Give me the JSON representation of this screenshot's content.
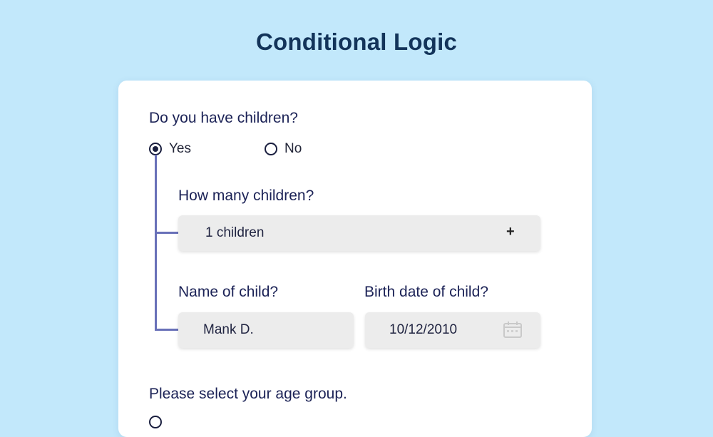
{
  "title": "Conditional Logic",
  "form": {
    "q1": {
      "label": "Do you have children?",
      "options": [
        {
          "label": "Yes",
          "checked": true
        },
        {
          "label": "No",
          "checked": false
        }
      ]
    },
    "q2": {
      "label": "How many children?",
      "value": "1 children",
      "action_icon": "plus-icon"
    },
    "q3": {
      "label": "Name of child?",
      "value": "Mank D."
    },
    "q4": {
      "label": "Birth date of child?",
      "value": "10/12/2010",
      "icon": "calendar-icon"
    },
    "q5": {
      "label": "Please select your age group."
    }
  },
  "colors": {
    "background": "#c2e8fb",
    "title": "#13345a",
    "question": "#1b2256",
    "connector": "#6870b8",
    "field": "#ececec"
  }
}
